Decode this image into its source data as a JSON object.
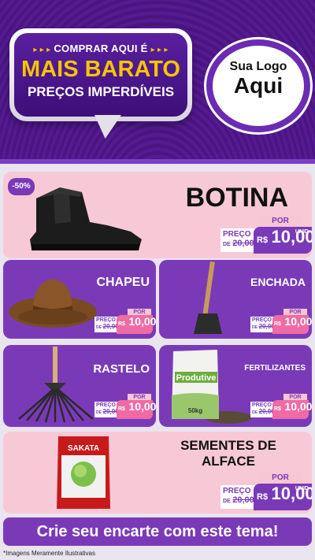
{
  "header": {
    "line1": "COMPRAR AQUI É",
    "line2": "MAIS BARATO",
    "line3": "PREÇOS IMPERDÍVEIS",
    "dots": "▸ ▸ ▸",
    "logo_small": "Sua Logo",
    "logo_big": "Aqui"
  },
  "products": [
    {
      "name": "BOTINA",
      "badge": "-50%",
      "por": "POR",
      "preco": "PREÇO",
      "de": "DE",
      "old": "20,00",
      "cur": "R$",
      "price": "10,00",
      "unid": "UNID",
      "icon": "boot-icon"
    },
    {
      "name": "CHAPEU",
      "por": "POR",
      "preco": "PREÇO",
      "de": "DE",
      "old": "20,00",
      "cur": "R$",
      "price": "10,00",
      "icon": "hat-icon"
    },
    {
      "name": "ENCHADA",
      "por": "POR",
      "preco": "PREÇO",
      "de": "DE",
      "old": "20,00",
      "cur": "R$",
      "price": "10,00",
      "icon": "hoe-icon"
    },
    {
      "name": "RASTELO",
      "por": "POR",
      "preco": "PREÇO",
      "de": "DE",
      "old": "20,00",
      "cur": "R$",
      "price": "10,00",
      "icon": "rake-icon"
    },
    {
      "name": "FERTILIZANTES",
      "por": "POR",
      "preco": "PREÇO",
      "de": "DE",
      "old": "20,00",
      "cur": "R$",
      "price": "10,00",
      "icon": "fertilizer-bag-icon",
      "bag_brand": "Produtive",
      "bag_weight": "50kg"
    },
    {
      "name": "SEMENTES DE ALFACE",
      "por": "POR",
      "preco": "PREÇO",
      "de": "DE",
      "old": "20,00",
      "cur": "R$",
      "price": "10,00",
      "unid": "UNID",
      "icon": "seed-packet-icon",
      "packet_brand": "SAKATA"
    }
  ],
  "footer": {
    "cta": "Crie seu encarte com este tema!",
    "disclaimer": "*Imagens Meramente Ilustrativas"
  },
  "colors": {
    "purple": "#7a3ab8",
    "pink": "#f7c9d7",
    "yellow": "#f6c400",
    "dark_purple": "#4a1580"
  }
}
